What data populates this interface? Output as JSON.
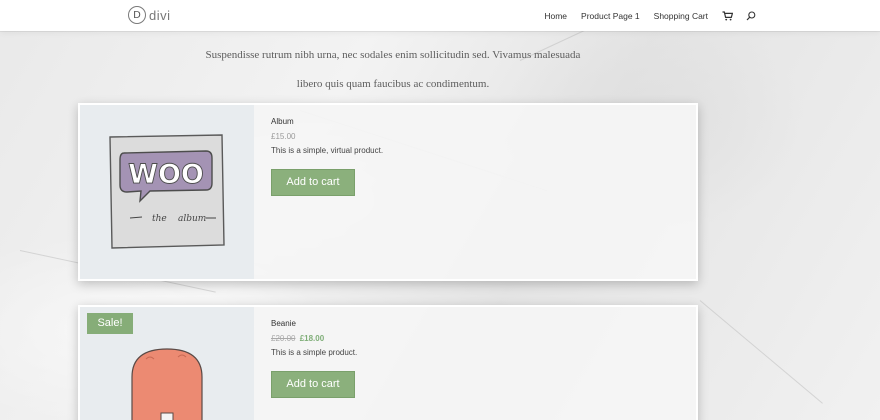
{
  "header": {
    "logo_letter": "D",
    "logo_text": "divi",
    "nav": [
      "Home",
      "Product Page 1",
      "Shopping Cart"
    ],
    "cart_icon": "cart-icon",
    "search_icon": "search-icon"
  },
  "intro": {
    "line1": "Suspendisse rutrum nibh urna, nec sodales enim sollicitudin sed. Vivamus malesuada",
    "line2": "libero quis quam faucibus ac condimentum."
  },
  "products": [
    {
      "name": "Album",
      "price": "£15.00",
      "description": "This is a simple, virtual product.",
      "button": "Add to cart",
      "image_text": "WOO",
      "image_caption_left": "the",
      "image_caption_right": "album"
    },
    {
      "name": "Beanie",
      "old_price": "£20.00",
      "price": "£18.00",
      "description": "This is a simple product.",
      "button": "Add to cart",
      "badge": "Sale!"
    }
  ],
  "colors": {
    "button": "#8bb07c",
    "sale_badge": "#86ad78",
    "sale_price": "#7fae78",
    "woo_purple": "#a493b4",
    "beanie": "#ec8a72"
  }
}
